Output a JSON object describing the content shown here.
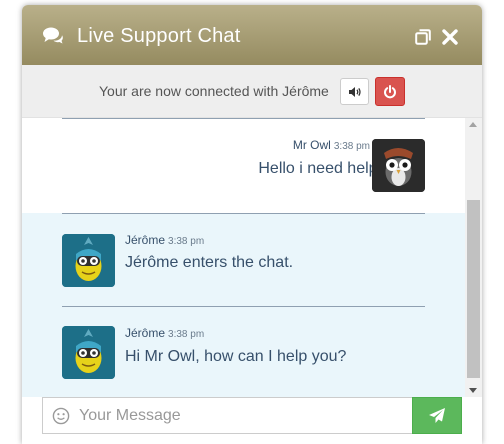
{
  "header": {
    "title": "Live Support Chat",
    "color": "#a59c72"
  },
  "status": {
    "text": "Your are now connected with Jérôme"
  },
  "messages": [
    {
      "author": "Mr Owl",
      "time": "3:38 pm",
      "text": "Hello i need help!",
      "side": "right",
      "avatar": "owl-avatar"
    },
    {
      "author": "Jérôme",
      "time": "3:38 pm",
      "text": "Jérôme enters the chat.",
      "side": "left",
      "avatar": "agent-avatar"
    },
    {
      "author": "Jérôme",
      "time": "3:38 pm",
      "text": "Hi Mr Owl, how can I help you?",
      "side": "left",
      "avatar": "agent-avatar"
    }
  ],
  "composer": {
    "placeholder": "Your Message",
    "value": ""
  },
  "colors": {
    "send": "#5cb85c",
    "power": "#d9534f",
    "agent_bg": "#eaf6fb",
    "text": "#37506b"
  }
}
